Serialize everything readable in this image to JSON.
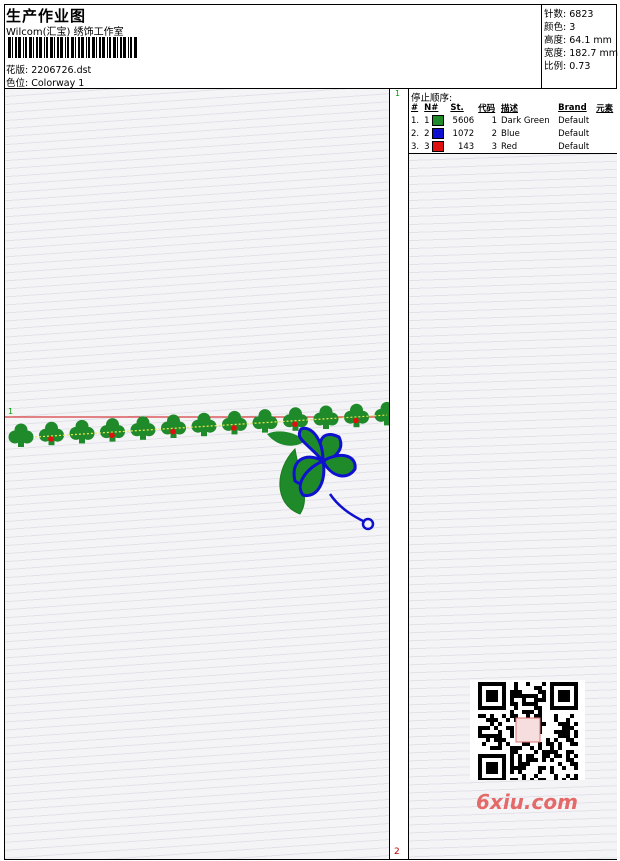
{
  "header": {
    "title": "生产作业图",
    "company": "Wilcom(汇宝) 绣饰工作室",
    "file_label": "花版:",
    "file_name": "2206726.dst",
    "colorway_label": "色位:",
    "colorway": "Colorway 1"
  },
  "stats": {
    "stitches_label": "针数:",
    "stitches": "6823",
    "colors_label": "颜色:",
    "colors": "3",
    "height_label": "高度:",
    "height": "64.1 mm",
    "width_label": "宽度:",
    "width": "182.7 mm",
    "scale_label": "比例:",
    "scale": "0.73"
  },
  "stop_sequence": {
    "title": "停止顺序:",
    "columns": [
      "#",
      "N#",
      "St.",
      "代码",
      "描述",
      "Brand",
      "元素"
    ],
    "rows": [
      {
        "index": "1.",
        "n": "1",
        "color": "#1f8a2a",
        "stitches": "5606",
        "code": "1",
        "desc": "Dark Green",
        "brand": "Default"
      },
      {
        "index": "2.",
        "n": "2",
        "color": "#1010d0",
        "stitches": "1072",
        "code": "2",
        "desc": "Blue",
        "brand": "Default"
      },
      {
        "index": "3.",
        "n": "3",
        "color": "#e01010",
        "stitches": "143",
        "code": "3",
        "desc": "Red",
        "brand": "Default"
      }
    ]
  },
  "markers": {
    "top": "1",
    "left": "1",
    "bottom": "2"
  },
  "watermark": {
    "logo_text": "6xiu.com"
  },
  "colors": {
    "guide_line": "#d01010",
    "green": "#1f8a2a",
    "blue": "#1010d0",
    "red": "#e01010"
  }
}
